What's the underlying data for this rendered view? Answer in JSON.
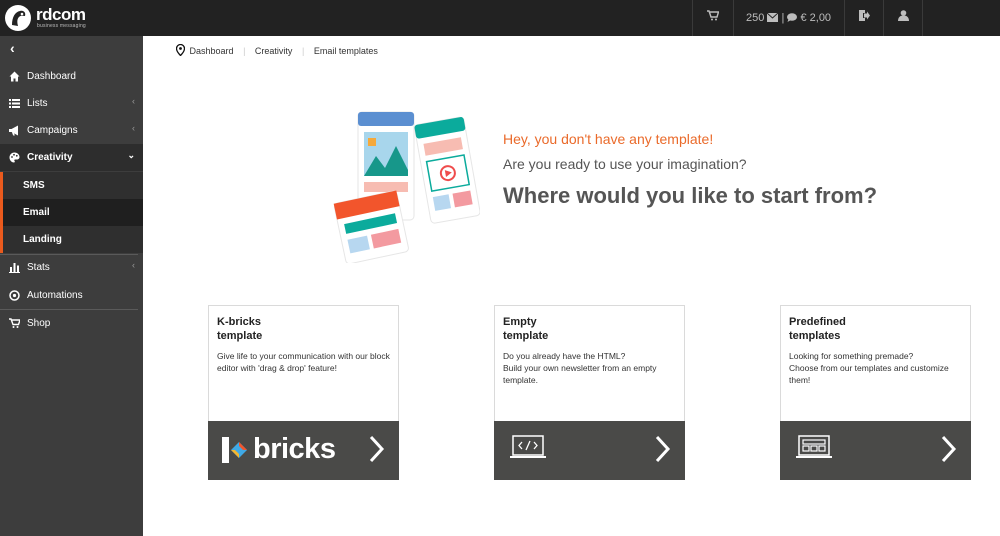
{
  "app": {
    "logo_text": "rdcom",
    "logo_sub": "business messaging"
  },
  "topbar": {
    "credits_count": "250",
    "credits_divider": "|",
    "balance": "€ 2,00"
  },
  "sidebar": {
    "items": [
      {
        "label": "Dashboard",
        "icon": "home-icon"
      },
      {
        "label": "Lists",
        "icon": "list-icon"
      },
      {
        "label": "Campaigns",
        "icon": "megaphone-icon"
      },
      {
        "label": "Creativity",
        "icon": "palette-icon"
      },
      {
        "label": "Stats",
        "icon": "bar-chart-icon"
      },
      {
        "label": "Automations",
        "icon": "automation-icon"
      },
      {
        "label": "Shop",
        "icon": "cart-icon"
      }
    ],
    "sub_items": [
      {
        "label": "SMS"
      },
      {
        "label": "Email"
      },
      {
        "label": "Landing"
      }
    ]
  },
  "breadcrumb": [
    "Dashboard",
    "Creativity",
    "Email templates"
  ],
  "hero": {
    "line1": "Hey, you don't have any template!",
    "line2": "Are you ready to use your imagination?",
    "line3": "Where would you like to start from?"
  },
  "cards": [
    {
      "title_line1": "K-bricks",
      "title_line2": "template",
      "desc": "Give life to your communication with our block editor with 'drag & drop' feature!",
      "footer_text": "bricks"
    },
    {
      "title_line1": "Empty",
      "title_line2": "template",
      "desc_line1": "Do you already have the HTML?",
      "desc_line2": "Build your own newsletter from an empty template."
    },
    {
      "title_line1": "Predefined",
      "title_line2": "templates",
      "desc_line1": "Looking for something premade?",
      "desc_line2": "Choose from our templates and customize them!"
    }
  ],
  "colors": {
    "accent": "#ea5a1d",
    "topbar": "#222222",
    "sidebar": "#3d3d3d",
    "card_footer": "#4a4a48"
  }
}
